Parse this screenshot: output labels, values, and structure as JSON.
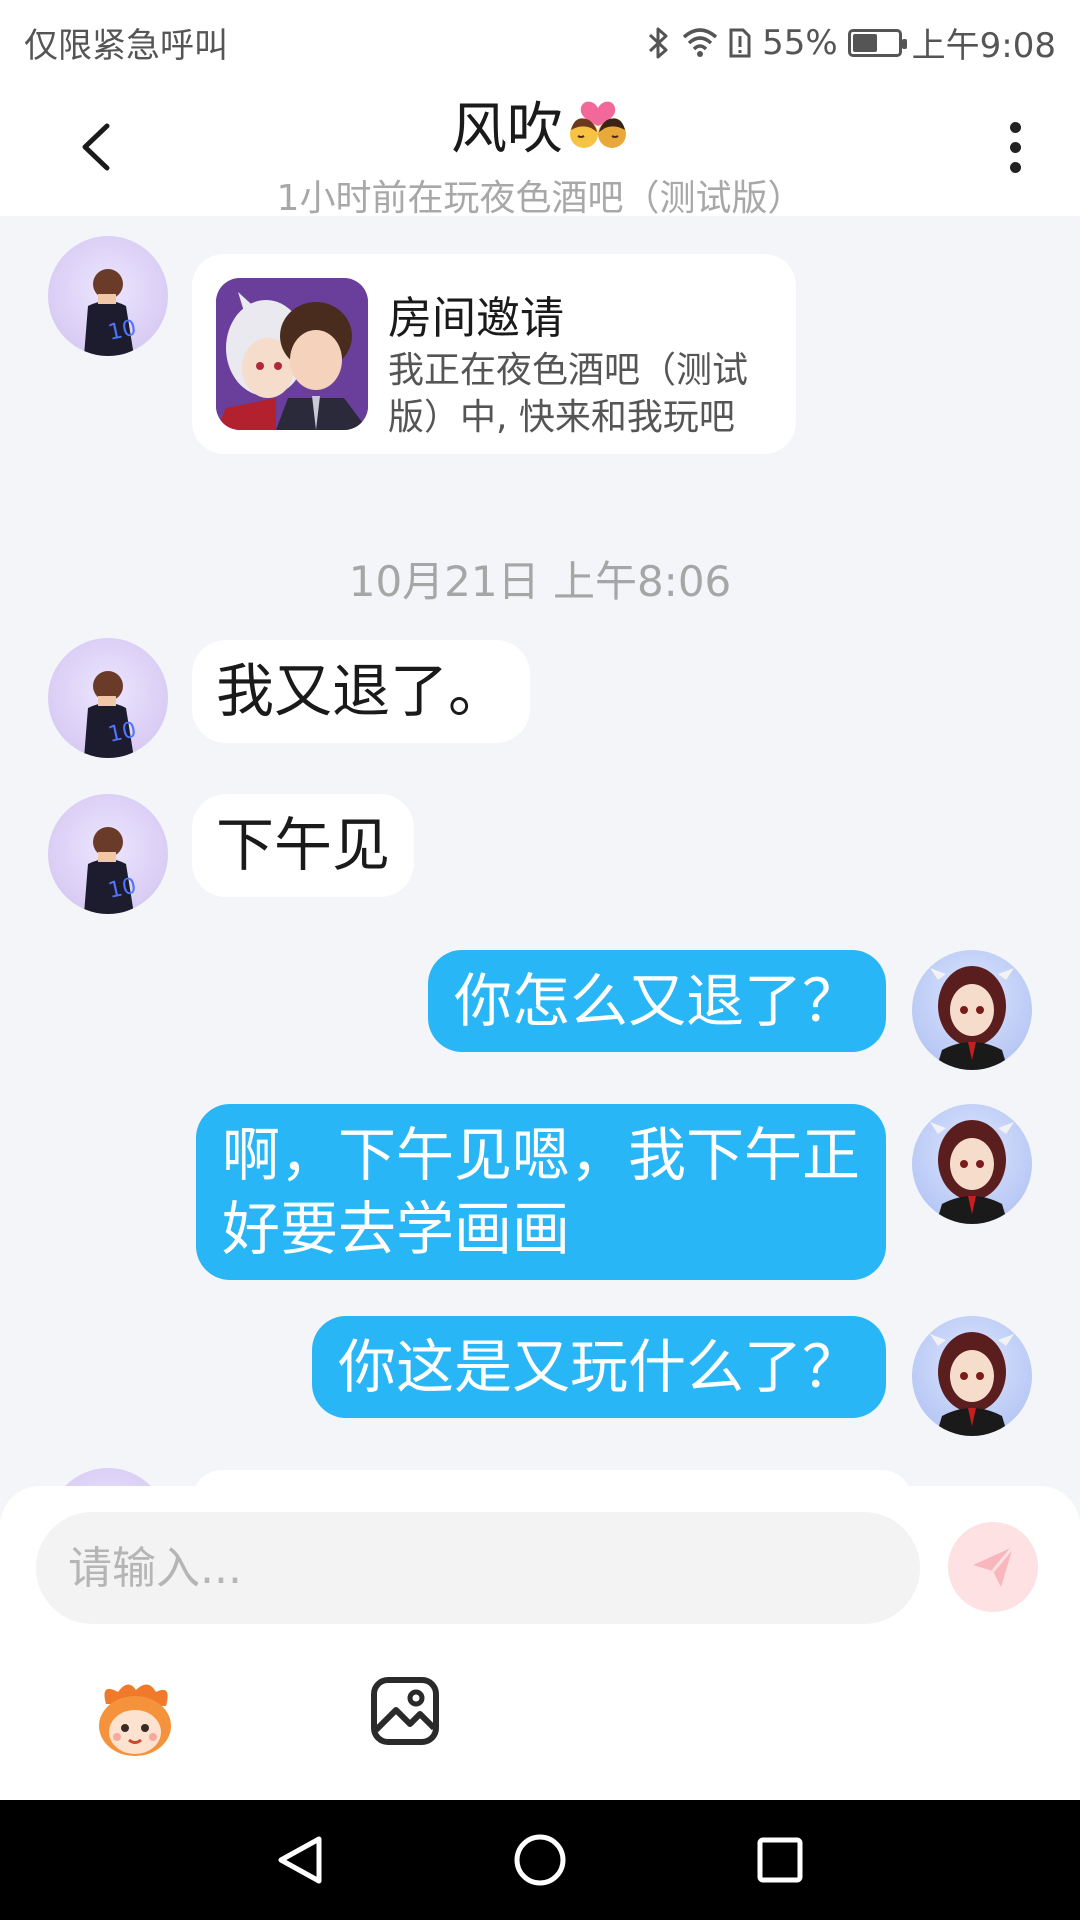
{
  "status_bar": {
    "left_text": "仅限紧急呼叫",
    "battery": "55%",
    "battery_level": 0.55,
    "time": "上午9:08",
    "icons": [
      "bluetooth-icon",
      "wifi-icon",
      "sim-alert-icon",
      "battery-icon"
    ]
  },
  "header": {
    "title": "风吹",
    "title_emoji": "kiss-emoji",
    "subtitle": "1小时前在玩夜色酒吧（测试版）",
    "back_icon": "back-arrow-icon",
    "more_icon": "more-vertical-icon"
  },
  "invite_card": {
    "title": "房间邀请",
    "description": "我正在夜色酒吧（测试版）中, 快来和我玩吧"
  },
  "timestamp": "10月21日 上午8:06",
  "messages": [
    {
      "side": "in",
      "text": "我又退了。"
    },
    {
      "side": "in",
      "text": "下午见"
    },
    {
      "side": "out",
      "text": "你怎么又退了？"
    },
    {
      "side": "out",
      "line1": "啊，下午见嗯，我下午正",
      "line2": "好要去学画画"
    },
    {
      "side": "out",
      "text": "你这是又玩什么了？"
    }
  ],
  "input": {
    "placeholder": "请输入...",
    "send_icon": "send-icon",
    "emoji_icon": "emoji-mascot-icon",
    "image_icon": "image-icon"
  },
  "nav": {
    "back_icon": "nav-back-icon",
    "home_icon": "nav-home-icon",
    "recents_icon": "nav-recents-icon"
  }
}
